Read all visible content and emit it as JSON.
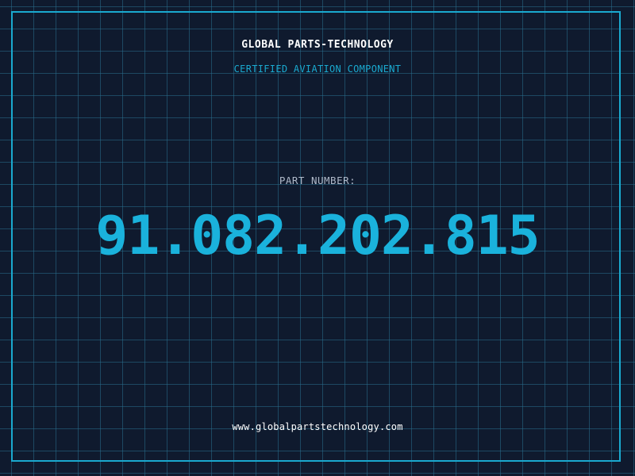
{
  "header": {
    "company": "GLOBAL PARTS-TECHNOLOGY",
    "tagline": "CERTIFIED AVIATION COMPONENT"
  },
  "part": {
    "label": "PART NUMBER:",
    "number": "91.082.202.815"
  },
  "footer": {
    "url": "www.globalpartstechnology.com"
  },
  "colors": {
    "background": "#0f1a2e",
    "accent": "#1ab2dc",
    "frame": "#1aa9cf"
  }
}
